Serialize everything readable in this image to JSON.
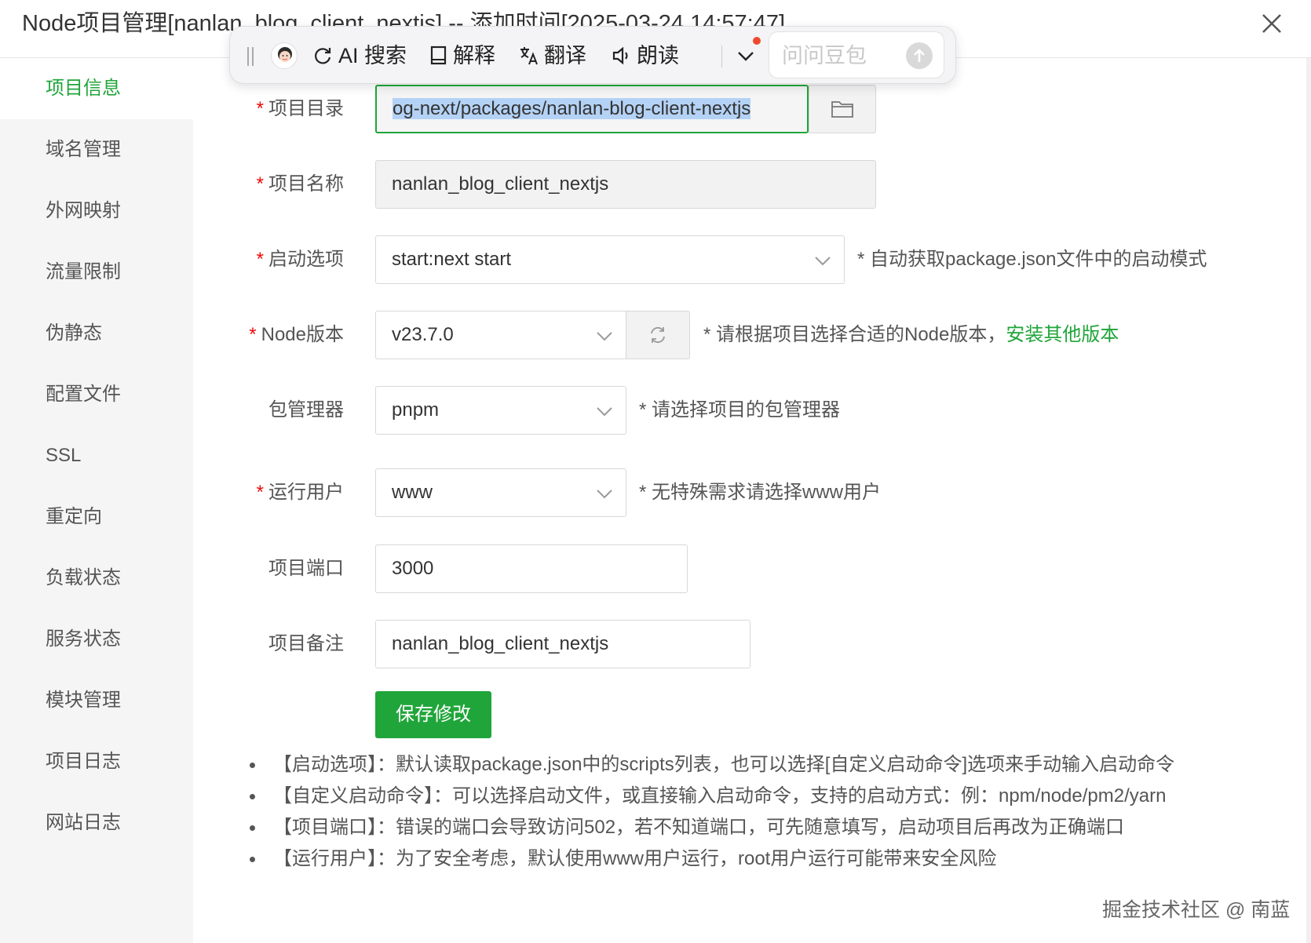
{
  "window": {
    "title": "Node项目管理[nanlan_blog_client_nextjs] -- 添加时间[2025-03-24 14:57:47]"
  },
  "sidebar": {
    "items": [
      {
        "label": "项目信息",
        "active": true
      },
      {
        "label": "域名管理"
      },
      {
        "label": "外网映射"
      },
      {
        "label": "流量限制"
      },
      {
        "label": "伪静态"
      },
      {
        "label": "配置文件"
      },
      {
        "label": "SSL"
      },
      {
        "label": "重定向"
      },
      {
        "label": "负载状态"
      },
      {
        "label": "服务状态"
      },
      {
        "label": "模块管理"
      },
      {
        "label": "项目日志"
      },
      {
        "label": "网站日志"
      }
    ]
  },
  "form": {
    "required_mark": "*",
    "project_dir": {
      "label": "项目目录",
      "value": "og-next/packages/nanlan-blog-client-nextjs"
    },
    "project_name": {
      "label": "项目名称",
      "value": "nanlan_blog_client_nextjs"
    },
    "start_option": {
      "label": "启动选项",
      "value": "start:next start",
      "hint": "* 自动获取package.json文件中的启动模式"
    },
    "node_version": {
      "label": "Node版本",
      "value": "v23.7.0",
      "hint": "* 请根据项目选择合适的Node版本，",
      "hint_link": "安装其他版本"
    },
    "package_manager": {
      "label": "包管理器",
      "value": "pnpm",
      "hint": "* 请选择项目的包管理器"
    },
    "run_user": {
      "label": "运行用户",
      "value": "www",
      "hint": "* 无特殊需求请选择www用户"
    },
    "project_port": {
      "label": "项目端口",
      "value": "3000"
    },
    "project_remark": {
      "label": "项目备注",
      "value": "nanlan_blog_client_nextjs"
    },
    "save_label": "保存修改"
  },
  "notes": [
    "【启动选项】：默认读取package.json中的scripts列表，也可以选择[自定义启动命令]选项来手动输入启动命令",
    "【自定义启动命令】：可以选择启动文件，或直接输入启动命令，支持的启动方式：例：npm/node/pm2/yarn",
    "【项目端口】：错误的端口会导致访问502，若不知道端口，可先随意填写，启动项目后再改为正确端口",
    "【运行用户】：为了安全考虑，默认使用www用户运行，root用户运行可能带来安全风险"
  ],
  "float_toolbar": {
    "tools": [
      "AI 搜索",
      "解释",
      "翻译",
      "朗读"
    ],
    "input_placeholder": "问问豆包"
  },
  "watermark": "掘金技术社区 @ 南蓝",
  "colors": {
    "accent": "#20a53a",
    "required": "#ef0808",
    "selection": "#b4d2f5",
    "sidebar_bg": "#f5f5f5"
  },
  "icons": {
    "close": "close-icon",
    "folder": "folder-icon",
    "refresh": "refresh-icon",
    "chevron": "chevron-down-icon"
  }
}
